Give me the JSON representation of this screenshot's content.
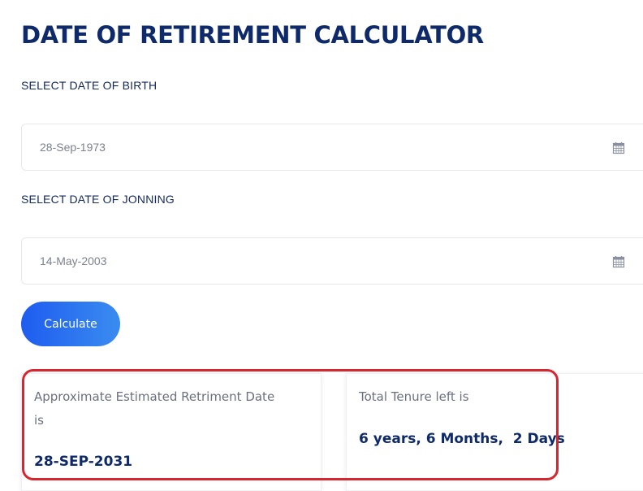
{
  "page": {
    "title": "DATE OF RETIREMENT CALCULATOR"
  },
  "dob": {
    "label": "SELECT DATE OF BIRTH",
    "value": "28-Sep-1973",
    "icon": "calendar-icon"
  },
  "doj": {
    "label": "SELECT DATE OF JONNING",
    "value": "14-May-2003",
    "icon": "calendar-icon"
  },
  "calculate_button": {
    "label": "Calculate"
  },
  "results": {
    "retirement": {
      "label_line1": "Approximate Estimated Retriment Date",
      "label_line2": "is",
      "value": "28-SEP-2031"
    },
    "tenure": {
      "label": "Total Tenure left is",
      "value": "6 years, 6 Months,  2 Days"
    }
  },
  "colors": {
    "title": "#0f2a6b",
    "button_gradient_start": "#1e5cf0",
    "button_gradient_end": "#3a8cf0",
    "highlight": "#d8262e"
  }
}
